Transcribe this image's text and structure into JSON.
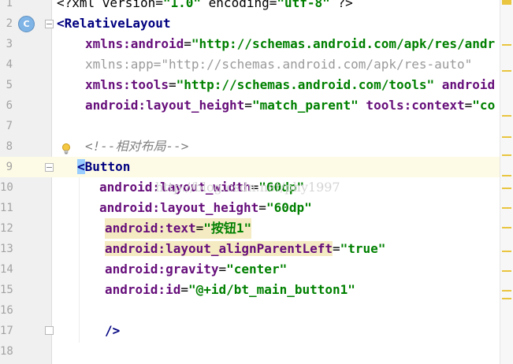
{
  "editor": {
    "line_numbers": [
      "1",
      "2",
      "3",
      "4",
      "5",
      "6",
      "7",
      "8",
      "9",
      "10",
      "11",
      "12",
      "13",
      "14",
      "15",
      "16",
      "17",
      "18"
    ],
    "line1": {
      "pre": "<?xml version=",
      "version": "\"1.0\"",
      "mid": " encoding=",
      "encoding": "\"utf-8\"",
      "post": " ?>"
    },
    "line2": {
      "open": "<",
      "tag": "RelativeLayout"
    },
    "line3": {
      "attr": "xmlns:android",
      "eq": "=",
      "val": "\"http://schemas.android.com/apk/res/andr"
    },
    "line4": {
      "attr": "xmlns:app",
      "eq": "=",
      "val": "\"http://schemas.android.com/apk/res-auto\""
    },
    "line5": {
      "attr": "xmlns:tools",
      "eq": "=",
      "val": "\"http://schemas.android.com/tools\"",
      "trail": " android"
    },
    "line6": {
      "attr": "android:layout_height",
      "eq": "=",
      "val": "\"match_parent\"",
      "attr2": " tools:context",
      "eq2": "=",
      "val2": "\"co"
    },
    "line8": {
      "comment": "<!--相对布局-->"
    },
    "line9": {
      "open": "<",
      "tag": "Button"
    },
    "line10": {
      "attr": "android:layout_width",
      "eq": "=",
      "val": "\"60dp\""
    },
    "line11": {
      "attr": "android:layout_height",
      "eq": "=",
      "val": "\"60dp\""
    },
    "line12": {
      "attr": "android:text",
      "eq": "=",
      "val": "\"按钮1\""
    },
    "line13": {
      "attr": "android:layout_alignParentLeft",
      "eq": "=",
      "val": "\"true\""
    },
    "line14": {
      "attr": "android:gravity",
      "eq": "=",
      "val": "\"center\""
    },
    "line15": {
      "attr": "android:id",
      "eq": "=",
      "val": "\"@+id/bt_main_button1\""
    },
    "line17": {
      "close": "/>"
    },
    "class_badge": "C",
    "watermark": "http://blog.csdn.net/phy1997"
  },
  "colors": {
    "tag": "#000080",
    "attribute": "#660e7a",
    "value": "#008000",
    "comment": "#808080",
    "warning_marker": "#e9c540",
    "caret_row": "#fdfbe5"
  },
  "icons": [
    "class-icon",
    "intention-bulb-icon",
    "fold-icon"
  ]
}
